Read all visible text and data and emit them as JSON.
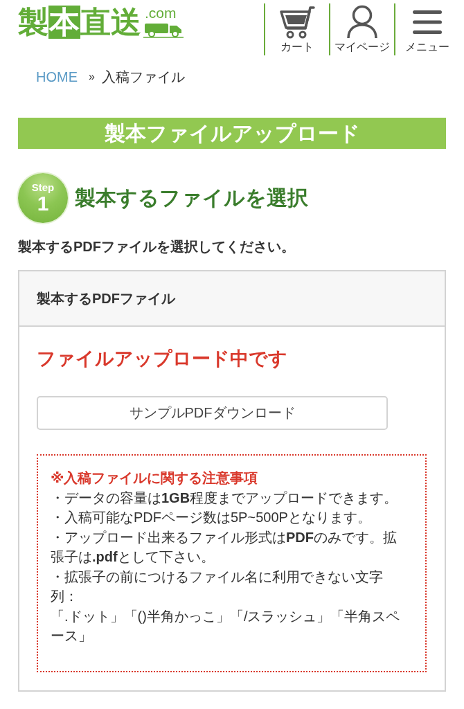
{
  "header": {
    "logo": {
      "parts": [
        {
          "text": "製",
          "boxed": false
        },
        {
          "text": "本",
          "boxed": true
        },
        {
          "text": "直送",
          "boxed": false
        }
      ],
      "domain": ".com"
    },
    "nav": [
      {
        "kind": "cart",
        "label": "カート"
      },
      {
        "kind": "account",
        "label": "マイページ"
      },
      {
        "kind": "menu",
        "label": "メニュー"
      }
    ]
  },
  "breadcrumb": {
    "separator": "»",
    "items": [
      {
        "kind": "link",
        "label": "HOME"
      },
      {
        "kind": "current",
        "label": "入稿ファイル"
      }
    ]
  },
  "banner": {
    "title": "製本ファイルアップロード"
  },
  "step": {
    "badge_label": "Step",
    "number": "1",
    "title": "製本するファイルを選択"
  },
  "instruction": "製本するPDFファイルを選択してください。",
  "file_panel": {
    "header": "製本するPDFファイル",
    "status": "ファイルアップロード中です",
    "sample_button": "サンプルPDFダウンロード",
    "notes": {
      "title": "※入稿ファイルに関する注意事項",
      "lines": [
        "・データの容量は**1GB**程度までアップロードできます。",
        "・入稿可能なPDFページ数は5P~500Pとなります。",
        "・アップロード出来るファイル形式は**PDF**のみです。拡張子は**.pdf**として下さい。",
        "・拡張子の前につけるファイル名に利用できない文字列：",
        "「.ドット」「()半角かっこ」「/スラッシュ」「半角スペース」"
      ]
    }
  }
}
